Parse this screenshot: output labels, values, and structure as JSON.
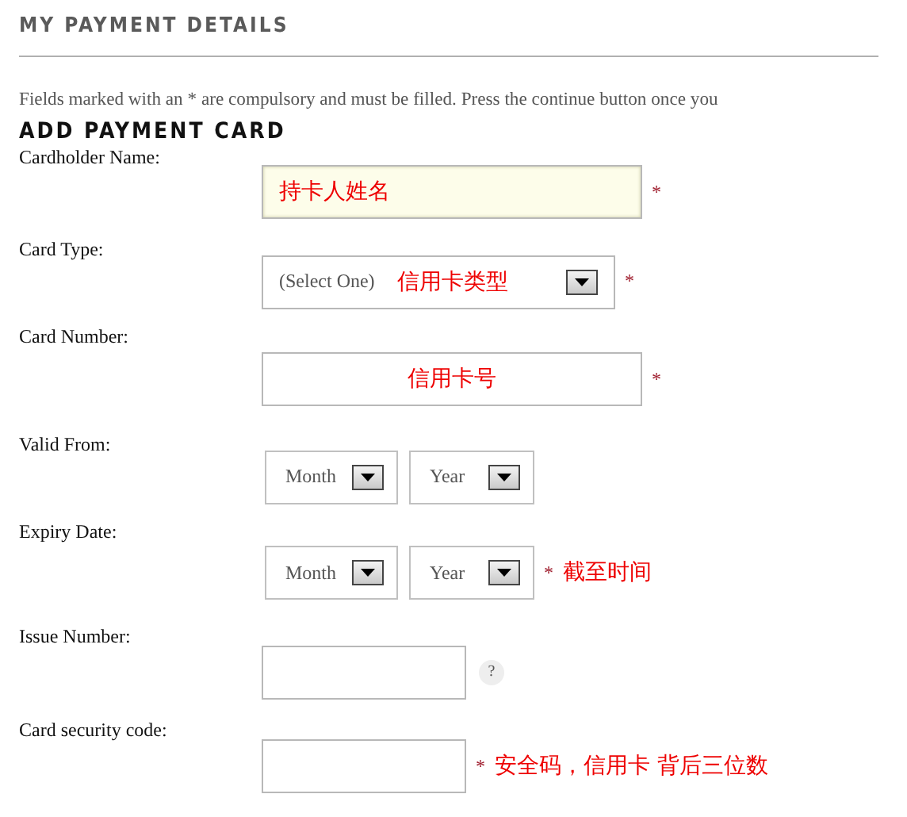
{
  "title": "MY PAYMENT DETAILS",
  "intro": "Fields marked with an * are compulsory and must be filled. Press the continue button once you",
  "section": "ADD PAYMENT CARD",
  "fields": [
    {
      "label": "Cardholder Name:",
      "kind": "text",
      "focused": true,
      "required": true,
      "required_mark": "*",
      "value": "持卡人姓名"
    },
    {
      "label": "Card Type:",
      "kind": "select",
      "focused": false,
      "required": true,
      "required_mark": "*",
      "value": "(Select One)",
      "note": "信用卡类型"
    },
    {
      "label": "Card Number:",
      "kind": "text",
      "focused": false,
      "required": true,
      "required_mark": "*",
      "value": "信用卡号"
    },
    {
      "label": "Valid From:",
      "kind": "date",
      "focused": false,
      "required": false,
      "selects": [
        "Month",
        "Year"
      ]
    },
    {
      "label": "Expiry Date:",
      "kind": "date",
      "focused": false,
      "required": true,
      "required_mark": "*",
      "selects": [
        "Month",
        "Year"
      ],
      "side_note": "截至时间"
    },
    {
      "label": "Issue Number:",
      "kind": "short",
      "focused": false,
      "required": false,
      "help": "?"
    },
    {
      "label": "Card security code:",
      "kind": "short",
      "focused": false,
      "required": true,
      "required_mark": "*",
      "side_note": "安全码，信用卡 背后三位数"
    }
  ]
}
